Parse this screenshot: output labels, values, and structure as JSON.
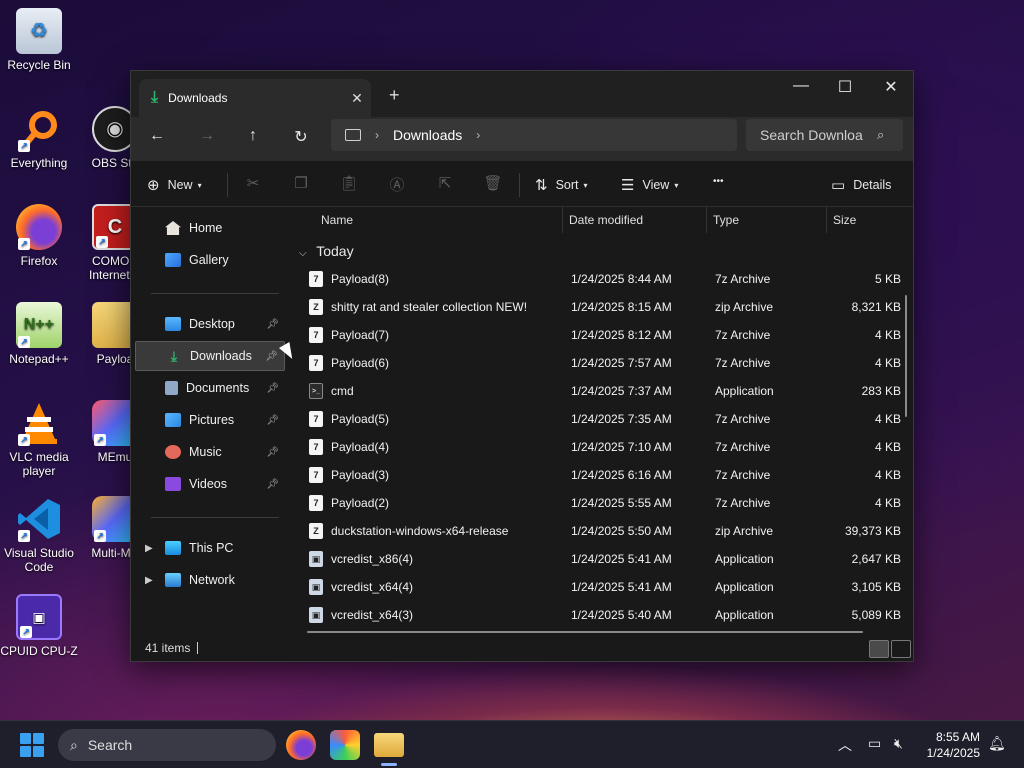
{
  "desktop": {
    "icons": [
      {
        "label": "Recycle Bin",
        "icon": "recycle-bin-icon"
      },
      {
        "label": "Everything",
        "icon": "everything-search-icon"
      },
      {
        "label": "OBS Stu",
        "icon": "obs-studio-icon"
      },
      {
        "label": "Firefox",
        "icon": "firefox-icon"
      },
      {
        "label": "COMOD",
        "label2": "Internet S",
        "icon": "comodo-icon"
      },
      {
        "label": "Notepad++",
        "icon": "notepad-plus-plus-icon"
      },
      {
        "label": "Payloa",
        "icon": "folder-icon"
      },
      {
        "label": "VLC media",
        "label2": "player",
        "icon": "vlc-icon"
      },
      {
        "label": "MEmu",
        "icon": "memu-icon"
      },
      {
        "label": "Visual Studio",
        "label2": "Code",
        "icon": "vscode-icon"
      },
      {
        "label": "Multi-ME",
        "icon": "multi-memu-icon"
      },
      {
        "label": "CPUID CPU-Z",
        "icon": "cpuz-icon"
      }
    ]
  },
  "window": {
    "tab_title": "Downloads",
    "new_tab": "+",
    "controls": {
      "minimize": "—",
      "maximize": "☐",
      "close": "✕"
    }
  },
  "navbar": {
    "back": "←",
    "forward": "→",
    "up": "↑",
    "refresh": "↻",
    "breadcrumb": [
      "Downloads"
    ],
    "search_placeholder": "Search Downloa"
  },
  "commandbar": {
    "new_label": "New",
    "sort_label": "Sort",
    "view_label": "View",
    "more_label": "•••",
    "details_label": "Details"
  },
  "sidebar": {
    "top": [
      {
        "label": "Home",
        "icon": "home-icon"
      },
      {
        "label": "Gallery",
        "icon": "gallery-icon"
      }
    ],
    "pinned": [
      {
        "label": "Desktop",
        "icon": "desktop-folder-icon",
        "selected": false
      },
      {
        "label": "Downloads",
        "icon": "downloads-folder-icon",
        "selected": true
      },
      {
        "label": "Documents",
        "icon": "documents-folder-icon",
        "selected": false
      },
      {
        "label": "Pictures",
        "icon": "pictures-folder-icon",
        "selected": false
      },
      {
        "label": "Music",
        "icon": "music-folder-icon",
        "selected": false
      },
      {
        "label": "Videos",
        "icon": "videos-folder-icon",
        "selected": false
      }
    ],
    "bottom": [
      {
        "label": "This PC",
        "icon": "this-pc-icon"
      },
      {
        "label": "Network",
        "icon": "network-icon"
      }
    ]
  },
  "content": {
    "columns": [
      "Name",
      "Date modified",
      "Type",
      "Size"
    ],
    "group": "Today",
    "files": [
      {
        "name": "Payload(8)",
        "date": "1/24/2025 8:44 AM",
        "type": "7z Archive",
        "size": "5 KB",
        "kind": "7z"
      },
      {
        "name": "shitty rat and stealer collection NEW!",
        "date": "1/24/2025 8:15 AM",
        "type": "zip Archive",
        "size": "8,321 KB",
        "kind": "zip"
      },
      {
        "name": "Payload(7)",
        "date": "1/24/2025 8:12 AM",
        "type": "7z Archive",
        "size": "4 KB",
        "kind": "7z"
      },
      {
        "name": "Payload(6)",
        "date": "1/24/2025 7:57 AM",
        "type": "7z Archive",
        "size": "4 KB",
        "kind": "7z"
      },
      {
        "name": "cmd",
        "date": "1/24/2025 7:37 AM",
        "type": "Application",
        "size": "283 KB",
        "kind": "app-cmd"
      },
      {
        "name": "Payload(5)",
        "date": "1/24/2025 7:35 AM",
        "type": "7z Archive",
        "size": "4 KB",
        "kind": "7z"
      },
      {
        "name": "Payload(4)",
        "date": "1/24/2025 7:10 AM",
        "type": "7z Archive",
        "size": "4 KB",
        "kind": "7z"
      },
      {
        "name": "Payload(3)",
        "date": "1/24/2025 6:16 AM",
        "type": "7z Archive",
        "size": "4 KB",
        "kind": "7z"
      },
      {
        "name": "Payload(2)",
        "date": "1/24/2025 5:55 AM",
        "type": "7z Archive",
        "size": "4 KB",
        "kind": "7z"
      },
      {
        "name": "duckstation-windows-x64-release",
        "date": "1/24/2025 5:50 AM",
        "type": "zip Archive",
        "size": "39,373 KB",
        "kind": "zip"
      },
      {
        "name": "vcredist_x86(4)",
        "date": "1/24/2025 5:41 AM",
        "type": "Application",
        "size": "2,647 KB",
        "kind": "app"
      },
      {
        "name": "vcredist_x64(4)",
        "date": "1/24/2025 5:41 AM",
        "type": "Application",
        "size": "3,105 KB",
        "kind": "app"
      },
      {
        "name": "vcredist_x64(3)",
        "date": "1/24/2025 5:40 AM",
        "type": "Application",
        "size": "5,089 KB",
        "kind": "app"
      }
    ]
  },
  "status": {
    "count": "41 items"
  },
  "taskbar": {
    "search_label": "Search",
    "time": "8:55 AM",
    "date": "1/24/2025"
  }
}
